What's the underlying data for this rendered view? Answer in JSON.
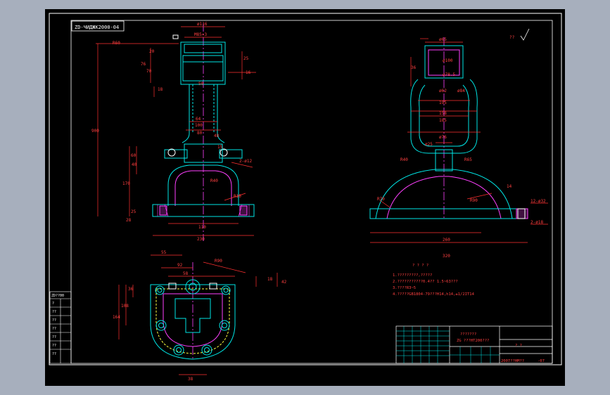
{
  "colors": {
    "background": "#000000",
    "window": "#a7afbd",
    "outline": "#00e5e5",
    "dimension": "#ff3030",
    "centerline": "#ff40ff",
    "text": "#ff4040",
    "white": "#ffffff",
    "yellow": "#ffff40"
  },
  "frame_label": "ZD-ЧИДЖК2000-04",
  "front_view": {
    "dims": [
      "ø116",
      "M85×3",
      "20",
      "76",
      "70",
      "18",
      "16",
      "25",
      "50",
      "64",
      "48",
      "900",
      "100",
      "80",
      "15",
      "60",
      "40",
      "2-ø12",
      "170",
      "25",
      "110",
      "230",
      "R40",
      "R10",
      "28",
      "R60"
    ]
  },
  "side_view": {
    "dims": [
      "ø65",
      "ø100",
      "ø78.5",
      "ø62",
      "ø84",
      "195",
      "158",
      "185",
      "ø76",
      "ø25",
      "R40",
      "R65",
      "R90",
      "R70",
      "14",
      "12-ø32",
      "2-ø18",
      "260",
      "320",
      "36"
    ]
  },
  "plan_view": {
    "dims": [
      "55",
      "92",
      "R90",
      "58",
      "18",
      "42",
      "36",
      "108",
      "164",
      "38"
    ]
  },
  "notes": {
    "heading": "? ? ? ?",
    "items": [
      "1.?????????,?????",
      "2.???????????0.4?? 1.5~63???",
      "3.????R3~5",
      "4.?????GB1804-79???H14,h14,±1/2IT14"
    ]
  },
  "title_block": {
    "name_line1": "???????",
    "name_line2": "ZG ???HT200???",
    "code": "2007??HM??",
    "sheet": "? ?",
    "part_no": "-07"
  },
  "left_strip": [
    "ZD??00",
    "?",
    "??",
    "??",
    "??",
    "??",
    "??",
    "??"
  ],
  "check_mark": "??"
}
